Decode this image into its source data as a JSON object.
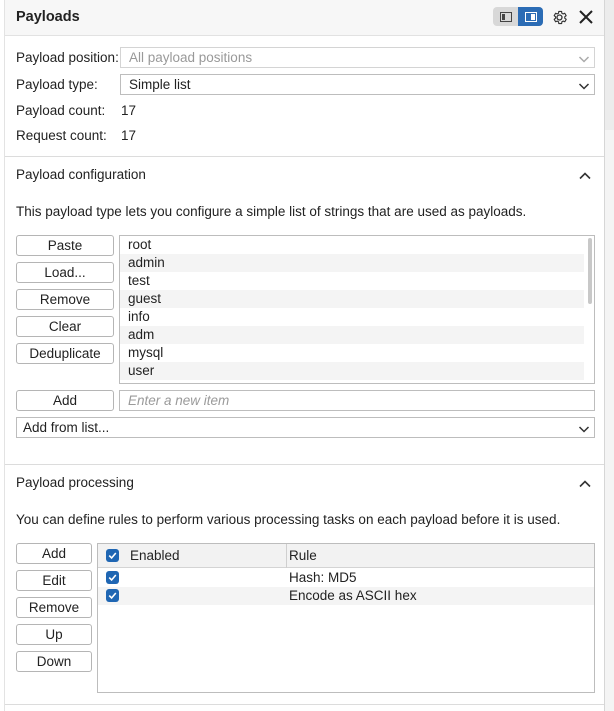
{
  "header": {
    "title": "Payloads",
    "icons": [
      "layout-left-icon",
      "layout-right-icon",
      "gear-icon",
      "close-icon"
    ]
  },
  "settings": {
    "position_label": "Payload position:",
    "position_value": "All payload positions",
    "type_label": "Payload type:",
    "type_value": "Simple list",
    "count_label": "Payload count:",
    "count_value": "17",
    "request_label": "Request count:",
    "request_value": "17"
  },
  "config": {
    "title": "Payload configuration",
    "description": "This payload type lets you configure a simple list of strings that are used as payloads.",
    "buttons": [
      "Paste",
      "Load...",
      "Remove",
      "Clear",
      "Deduplicate"
    ],
    "items": [
      "root",
      "admin",
      "test",
      "guest",
      "info",
      "adm",
      "mysql",
      "user"
    ],
    "add_label": "Add",
    "add_placeholder": "Enter a new item",
    "add_from_list": "Add from list..."
  },
  "processing": {
    "title": "Payload processing",
    "description": "You can define rules to perform various processing tasks on each payload before it is used.",
    "buttons": [
      "Add",
      "Edit",
      "Remove",
      "Up",
      "Down"
    ],
    "col_enabled": "Enabled",
    "col_rule": "Rule",
    "rules": [
      {
        "enabled": true,
        "rule": "Hash: MD5"
      },
      {
        "enabled": true,
        "rule": "Encode as ASCII hex"
      }
    ]
  },
  "colors": {
    "accent": "#2b6cb5",
    "checkbox": "#1f66b3"
  }
}
